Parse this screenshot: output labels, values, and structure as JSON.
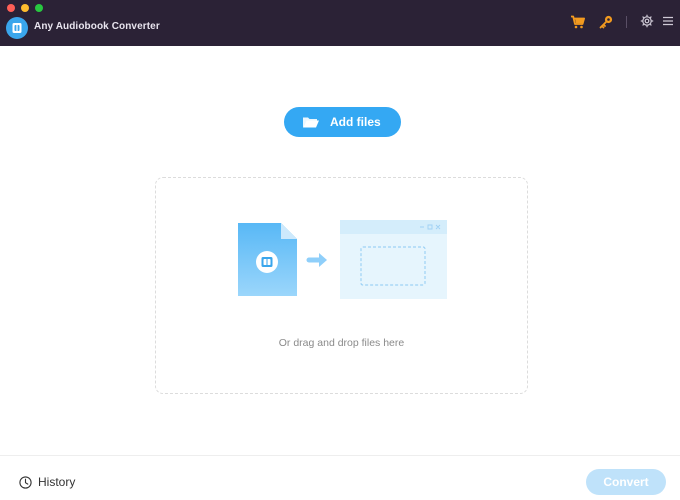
{
  "window": {
    "title": "Any Audiobook Converter"
  },
  "toolbar": {
    "icons": [
      "cart-icon",
      "key-icon",
      "gear-icon",
      "menu-icon"
    ],
    "accent_color": "#f29a1f"
  },
  "main": {
    "add_files_label": "Add files",
    "drop_hint": "Or drag and drop files here",
    "accent_color": "#34a8f3"
  },
  "footer": {
    "history_label": "History",
    "convert_label": "Convert",
    "convert_enabled": false
  }
}
